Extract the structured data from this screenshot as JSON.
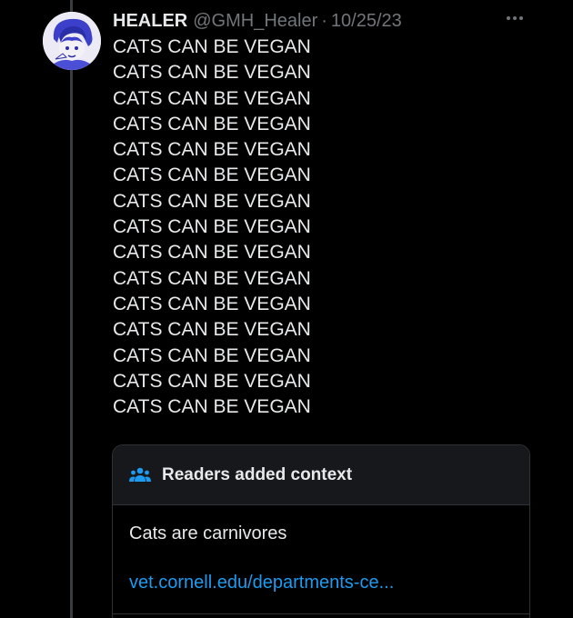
{
  "tweet": {
    "author": {
      "display_name": "HEALER",
      "handle": "@GMH_Healer",
      "separator": "·",
      "date": "10/25/23",
      "avatar": "anime-character-avatar"
    },
    "more_icon": "more-horizontal-icon",
    "lines": [
      "CATS CAN BE VEGAN",
      "CATS CAN BE VEGAN",
      "CATS CAN BE VEGAN",
      "CATS CAN BE VEGAN",
      "CATS CAN BE VEGAN",
      "CATS CAN BE VEGAN",
      "CATS CAN BE VEGAN",
      "CATS CAN BE VEGAN",
      "CATS CAN BE VEGAN",
      "CATS CAN BE VEGAN",
      "CATS CAN BE VEGAN",
      "CATS CAN BE VEGAN",
      "CATS CAN BE VEGAN",
      "CATS CAN BE VEGAN",
      "CATS CAN BE VEGAN"
    ]
  },
  "community_note": {
    "icon": "people-icon",
    "title": "Readers added context",
    "note": "Cats are carnivores",
    "link": "vet.cornell.edu/departments-ce..."
  },
  "colors": {
    "background": "#000000",
    "text": "#e7e9ea",
    "muted": "#71767b",
    "link": "#1d9bf0",
    "card_header": "#16181c",
    "border": "#2f3336"
  }
}
